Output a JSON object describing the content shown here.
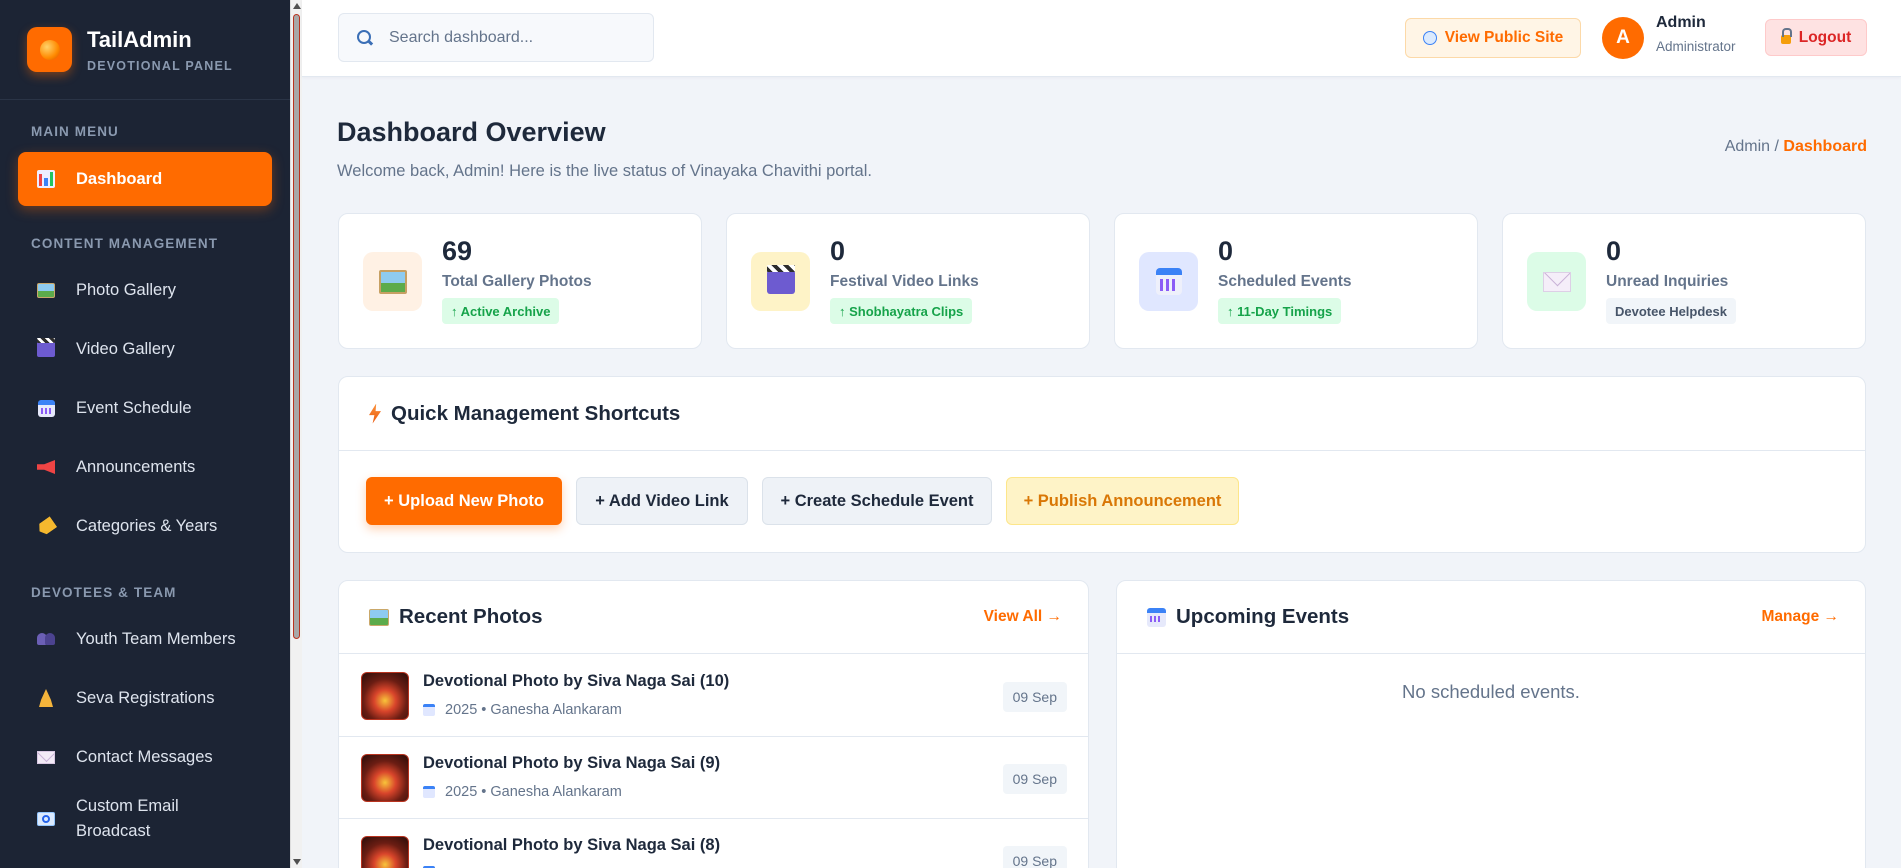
{
  "brand": {
    "title": "TailAdmin",
    "subtitle": "DEVOTIONAL PANEL"
  },
  "sidebar": {
    "sections": [
      {
        "label": "MAIN MENU"
      },
      {
        "label": "CONTENT MANAGEMENT"
      },
      {
        "label": "DEVOTEES & TEAM"
      }
    ],
    "items": [
      {
        "label": "Dashboard",
        "icon": "bar-chart-icon",
        "active": true
      },
      {
        "label": "Photo Gallery",
        "icon": "picture-icon"
      },
      {
        "label": "Video Gallery",
        "icon": "clapper-icon"
      },
      {
        "label": "Event Schedule",
        "icon": "calendar-icon"
      },
      {
        "label": "Announcements",
        "icon": "megaphone-icon"
      },
      {
        "label": "Categories & Years",
        "icon": "tag-icon"
      },
      {
        "label": "Youth Team Members",
        "icon": "people-icon"
      },
      {
        "label": "Seva Registrations",
        "icon": "praying-hands-icon"
      },
      {
        "label": "Contact Messages",
        "icon": "envelope-icon"
      },
      {
        "label": "Custom Email Broadcast",
        "icon": "email-icon"
      }
    ]
  },
  "header": {
    "search_placeholder": "Search dashboard...",
    "view_public_site": "View Public Site",
    "user": {
      "initial": "A",
      "name": "Admin",
      "role": "Administrator"
    },
    "logout": "Logout"
  },
  "page": {
    "title": "Dashboard Overview",
    "subtitle": "Welcome back, Admin! Here is the live status of Vinayaka Chavithi portal.",
    "breadcrumb": {
      "root": "Admin /",
      "current": "Dashboard"
    }
  },
  "stats": [
    {
      "value": "69",
      "label": "Total Gallery Photos",
      "tag": "↑ Active Archive",
      "icon": "picture-icon",
      "bg": "#fff1e4"
    },
    {
      "value": "0",
      "label": "Festival Video Links",
      "tag": "↑ Shobhayatra Clips",
      "icon": "clapper-icon",
      "bg": "#fef3c7"
    },
    {
      "value": "0",
      "label": "Scheduled Events",
      "tag": "↑ 11-Day Timings",
      "icon": "calendar-icon",
      "bg": "#e0e7ff"
    },
    {
      "value": "0",
      "label": "Unread Inquiries",
      "tag": "Devotee Helpdesk",
      "icon": "envelope-icon",
      "bg": "#dcfce7"
    }
  ],
  "shortcuts": {
    "title": "Quick Management Shortcuts",
    "buttons": [
      "+ Upload New Photo",
      "+ Add Video Link",
      "+ Create Schedule Event",
      "+ Publish Announcement"
    ]
  },
  "recent_photos": {
    "title": "Recent Photos",
    "link": "View All →",
    "rows": [
      {
        "title": "Devotional Photo by Siva Naga Sai (10)",
        "meta": "2025 • Ganesha Alankaram",
        "date": "09 Sep"
      },
      {
        "title": "Devotional Photo by Siva Naga Sai (9)",
        "meta": "2025 • Ganesha Alankaram",
        "date": "09 Sep"
      },
      {
        "title": "Devotional Photo by Siva Naga Sai (8)",
        "meta": "",
        "date": "09 Sep"
      }
    ]
  },
  "upcoming_events": {
    "title": "Upcoming Events",
    "link": "Manage →",
    "empty": "No scheduled events."
  }
}
